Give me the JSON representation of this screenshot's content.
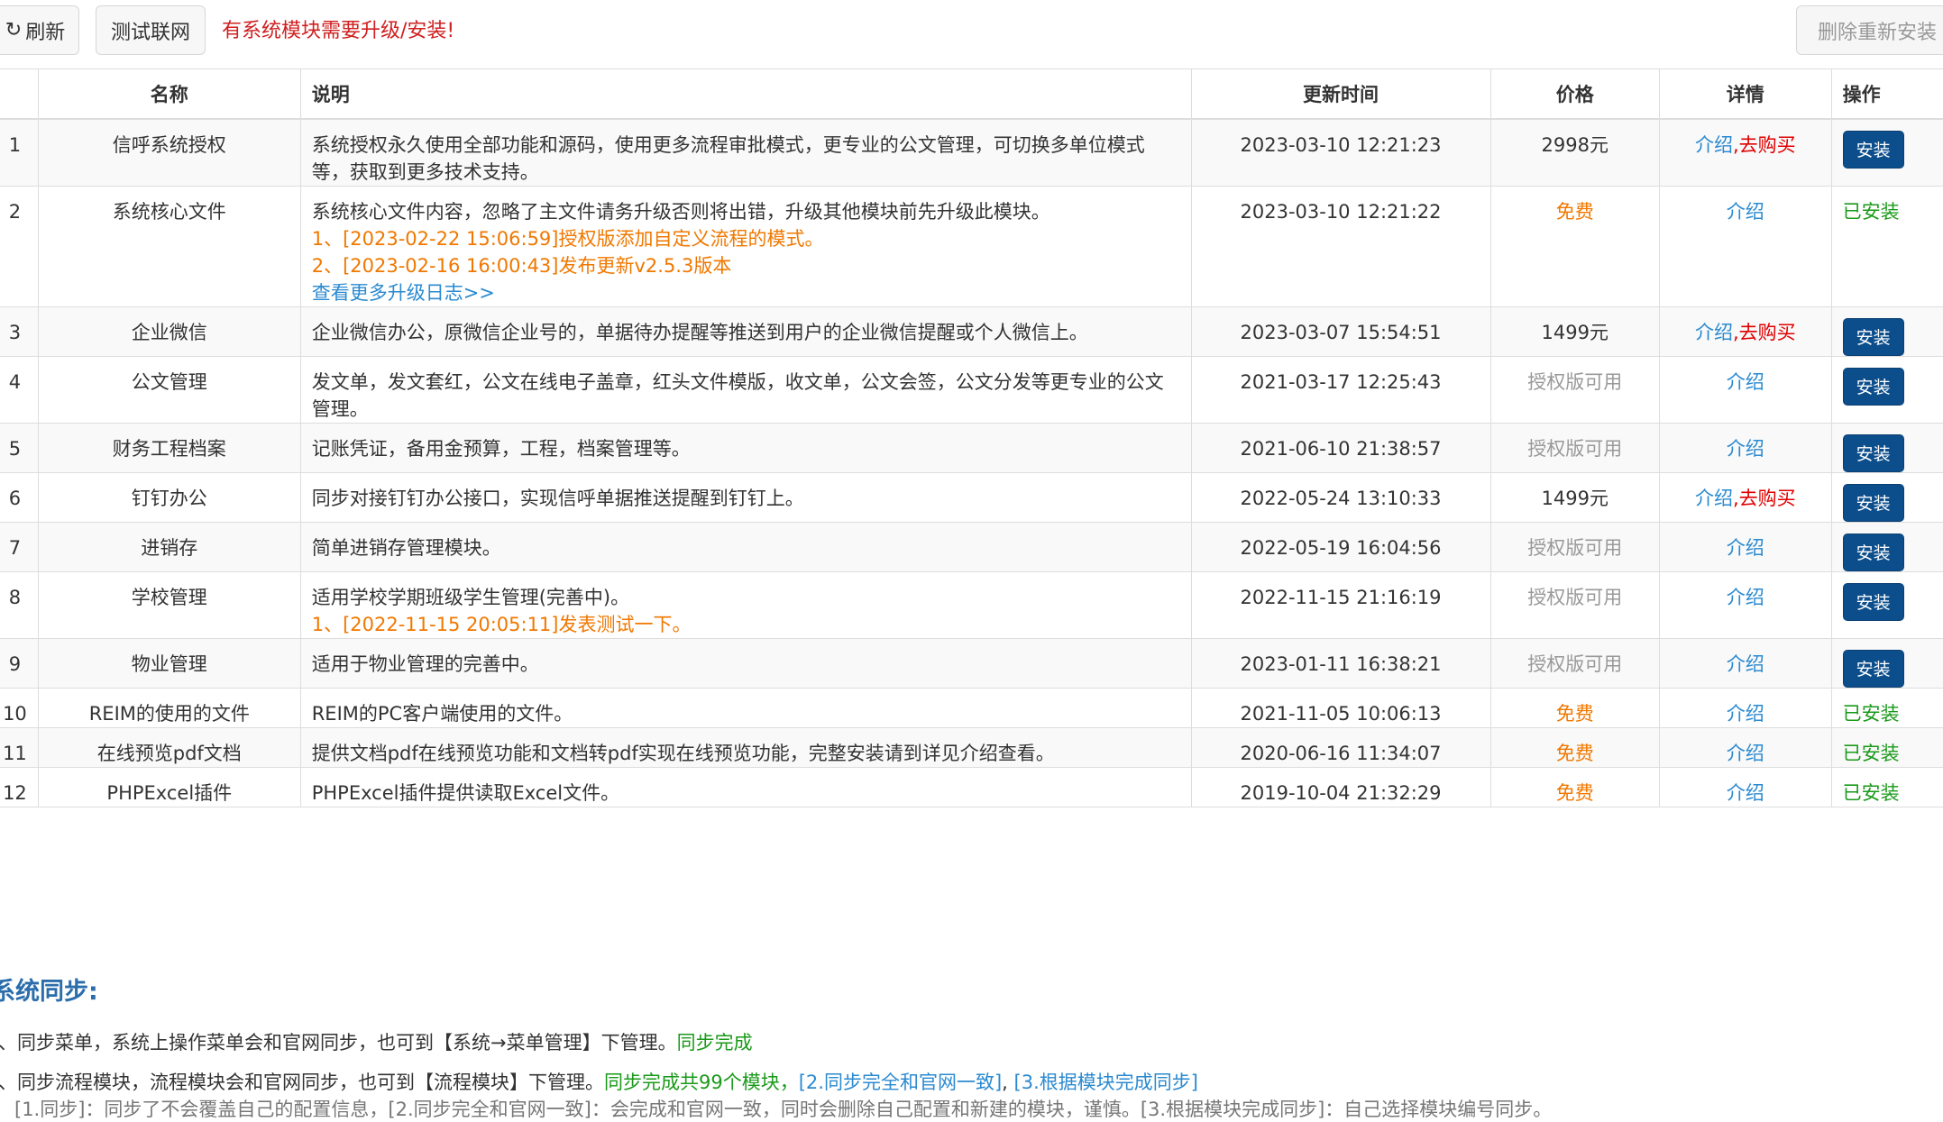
{
  "toolbar": {
    "refresh_label": "刷新",
    "refresh_icon": "refresh-icon",
    "test_label": "测试联网",
    "notice": "有系统模块需要升级/安装!",
    "reinstall_label": "删除重新安装"
  },
  "table": {
    "headers": {
      "name": "名称",
      "desc": "说明",
      "time": "更新时间",
      "price": "价格",
      "detail": "详情",
      "op": "操作"
    },
    "rows": [
      {
        "idx": "1",
        "name": "信呼系统授权",
        "desc": "系统授权永久使用全部功能和源码，使用更多流程审批模式，更专业的公文管理，可切换多单位模式等，获取到更多技术支持。",
        "time": "2023-03-10 12:21:23",
        "price": "2998元",
        "intro": "介绍",
        "buy": ",去购买",
        "action": "安装"
      },
      {
        "idx": "2",
        "name": "系统核心文件",
        "desc": "系统核心文件内容，忽略了主文件请务升级否则将出错，升级其他模块前先升级此模块。",
        "log1": "1、[2023-02-22 15:06:59]授权版添加自定义流程的模式。",
        "log2": "2、[2023-02-16 16:00:43]发布更新v2.5.3版本",
        "log_more": "查看更多升级日志>>",
        "time": "2023-03-10 12:21:22",
        "price": "免费",
        "intro": "介绍",
        "action": "已安装"
      },
      {
        "idx": "3",
        "name": "企业微信",
        "desc": "企业微信办公，原微信企业号的，单据待办提醒等推送到用户的企业微信提醒或个人微信上。",
        "time": "2023-03-07 15:54:51",
        "price": "1499元",
        "intro": "介绍",
        "buy": ",去购买",
        "action": "安装"
      },
      {
        "idx": "4",
        "name": "公文管理",
        "desc": "发文单，发文套红，公文在线电子盖章，红头文件模版，收文单，公文会签，公文分发等更专业的公文管理。",
        "time": "2021-03-17 12:25:43",
        "price": "授权版可用",
        "intro": "介绍",
        "action": "安装"
      },
      {
        "idx": "5",
        "name": "财务工程档案",
        "desc": "记账凭证，备用金预算，工程，档案管理等。",
        "time": "2021-06-10 21:38:57",
        "price": "授权版可用",
        "intro": "介绍",
        "action": "安装"
      },
      {
        "idx": "6",
        "name": "钉钉办公",
        "desc": "同步对接钉钉办公接口，实现信呼单据推送提醒到钉钉上。",
        "time": "2022-05-24 13:10:33",
        "price": "1499元",
        "intro": "介绍",
        "buy": ",去购买",
        "action": "安装"
      },
      {
        "idx": "7",
        "name": "进销存",
        "desc": "简单进销存管理模块。",
        "time": "2022-05-19 16:04:56",
        "price": "授权版可用",
        "intro": "介绍",
        "action": "安装"
      },
      {
        "idx": "8",
        "name": "学校管理",
        "desc": "适用学校学期班级学生管理(完善中)。",
        "log1": "1、[2022-11-15 20:05:11]发表测试一下。",
        "time": "2022-11-15 21:16:19",
        "price": "授权版可用",
        "intro": "介绍",
        "action": "安装"
      },
      {
        "idx": "9",
        "name": "物业管理",
        "desc": "适用于物业管理的完善中。",
        "time": "2023-01-11 16:38:21",
        "price": "授权版可用",
        "intro": "介绍",
        "action": "安装"
      },
      {
        "idx": "10",
        "name": "REIM的使用的文件",
        "desc": "REIM的PC客户端使用的文件。",
        "time": "2021-11-05 10:06:13",
        "price": "免费",
        "intro": "介绍",
        "action": "已安装"
      },
      {
        "idx": "11",
        "name": "在线预览pdf文档",
        "desc": "提供文档pdf在线预览功能和文档转pdf实现在线预览功能，完整安装请到详见介绍查看。",
        "time": "2020-06-16 11:34:07",
        "price": "免费",
        "intro": "介绍",
        "action": "已安装"
      },
      {
        "idx": "12",
        "name": "PHPExcel插件",
        "desc": "PHPExcel插件提供读取Excel文件。",
        "time": "2019-10-04 21:32:29",
        "price": "免费",
        "intro": "介绍",
        "action": "已安装"
      }
    ]
  },
  "sync": {
    "title": "系统同步:",
    "line1_text": "、同步菜单，系统上操作菜单会和官网同步，也可到【系统→菜单管理】下管理。",
    "line1_status": "同步完成",
    "line2_text": "、同步流程模块，流程模块会和官网同步，也可到【流程模块】下管理。",
    "line2_status": "同步完成共99个模块，",
    "line2_link1": "[2.同步完全和官网一致]",
    "line2_link2": "[3.根据模块完成同步]",
    "note": "[1.同步]：同步了不会覆盖自己的配置信息，[2.同步完全和官网一致]：会完成和官网一致，同时会删除自己配置和新建的模块，谨慎。[3.根据模块完成同步]：自己选择模块编号同步。"
  }
}
